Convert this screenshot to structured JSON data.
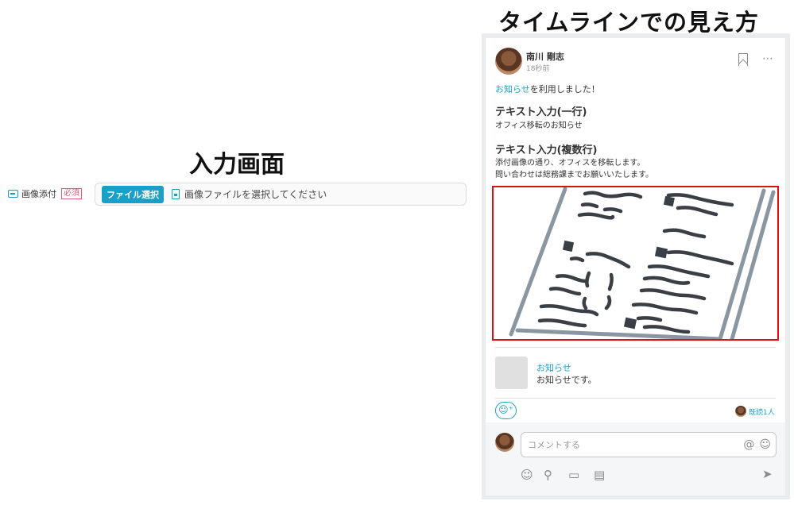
{
  "input_screen": {
    "title": "入力画面",
    "field_label": "画像添付",
    "required_badge": "必須",
    "file_button": "ファイル選択",
    "file_hint": "画像ファイルを選択してください"
  },
  "timeline_screen": {
    "title": "タイムラインでの見え方",
    "post": {
      "author": "南川 剛志",
      "time": "18秒前",
      "intro_link": "お知らせ",
      "intro_rest": "を利用しました！",
      "sections": [
        {
          "title": "テキスト入力(一行)",
          "lines": [
            "オフィス移転のお知らせ"
          ]
        },
        {
          "title": "テキスト入力(複数行)",
          "lines": [
            "添付画像の通り、オフィスを移転します。",
            "問い合わせは総務課までお願いいたします。"
          ]
        }
      ],
      "more": "⋯"
    },
    "notice": {
      "title": "お知らせ",
      "body": "お知らせです。"
    },
    "reaction_button": "☺⁺",
    "read_status": "既読1人",
    "comment": {
      "placeholder": "コメントする",
      "at": "@",
      "smile": "☺"
    },
    "toolbar_icons": [
      "smile-icon",
      "stamp-icon",
      "image-icon",
      "file-icon",
      "send-icon"
    ]
  },
  "colors": {
    "accent": "#1aa0c8",
    "highlight_border": "#e01010",
    "required": "#e05a7a"
  }
}
